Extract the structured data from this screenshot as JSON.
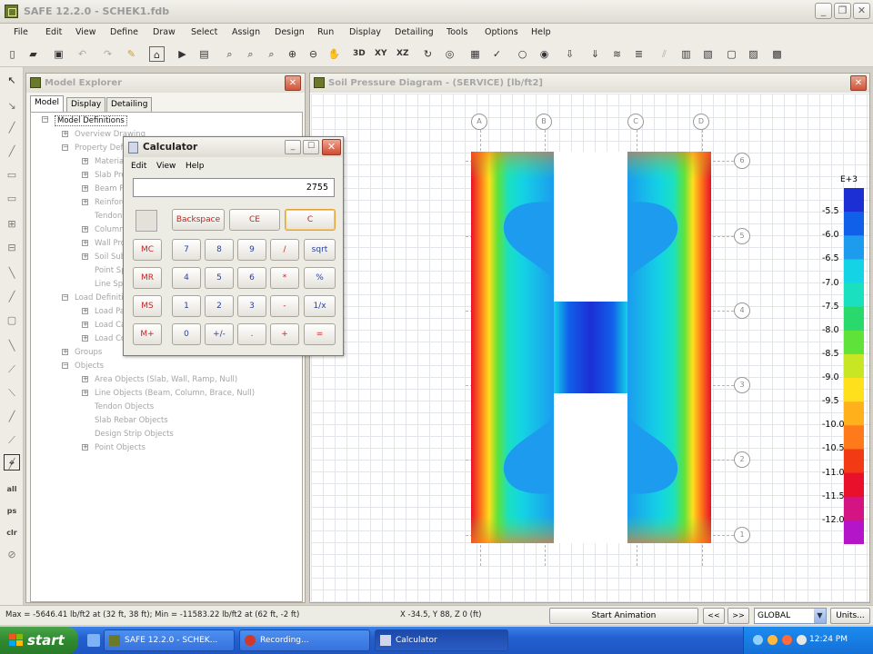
{
  "app": {
    "title": "SAFE 12.2.0 - SCHEK1.fdb"
  },
  "menu": [
    "File",
    "Edit",
    "View",
    "Define",
    "Draw",
    "Select",
    "Assign",
    "Design",
    "Run",
    "Display",
    "Detailing",
    "Tools",
    "Options",
    "Help"
  ],
  "toolbar": {
    "btn_3d": "3D",
    "btn_xy": "XY",
    "btn_xz": "XZ"
  },
  "left_toolbar": {
    "btn_all": "all",
    "btn_ps": "ps",
    "btn_clr": "clr"
  },
  "explorer": {
    "title": "Model Explorer",
    "tabs": [
      "Model",
      "Display",
      "Detailing"
    ],
    "tree": {
      "root": "Model Definitions",
      "drawing": "Overview Drawing",
      "property": "Property Definitions",
      "p1": "Materials",
      "p2": "Slab Properties",
      "p3": "Beam Properties",
      "p4": "Reinforcing Bar Sizes",
      "p5": "Tendon Properties",
      "p6": "Column Properties",
      "p7": "Wall Properties",
      "p8": "Soil Subgrade Properties",
      "p9": "Point Spring Properties",
      "p10": "Line Spring Properties",
      "load": "Load Definitions",
      "l1": "Load Patterns",
      "l2": "Load Cases",
      "l3": "Load Combinations",
      "groups": "Groups",
      "objects": "Objects",
      "o1": "Area Objects (Slab, Wall, Ramp, Null)",
      "o2": "Line Objects (Beam, Column, Brace, Null)",
      "o3": "Tendon Objects",
      "o4": "Slab Rebar Objects",
      "o5": "Design Strip Objects",
      "o6": "Point Objects"
    }
  },
  "plot": {
    "title": "Soil Pressure Diagram - (SERVICE)  [lb/ft2]",
    "grid_cols": [
      "A",
      "B",
      "C",
      "D"
    ],
    "grid_rows": [
      "6",
      "5",
      "4",
      "3",
      "2",
      "1"
    ]
  },
  "legend": {
    "exponent": "E+3",
    "values": [
      "-5.5",
      "-6.0",
      "-6.5",
      "-7.0",
      "-7.5",
      "-8.0",
      "-8.5",
      "-9.0",
      "-9.5",
      "-10.0",
      "-10.5",
      "-11.0",
      "-11.5",
      "-12.0"
    ],
    "colors": [
      "#1c2fd4",
      "#1160ea",
      "#1c9bef",
      "#13d3e4",
      "#1be0c0",
      "#29d96c",
      "#5fe33a",
      "#c8e624",
      "#ffe01d",
      "#ffb01b",
      "#ff7a1a",
      "#f23a14",
      "#e8102a",
      "#d31482",
      "#b415c8"
    ]
  },
  "calculator": {
    "title": "Calculator",
    "menu": [
      "Edit",
      "View",
      "Help"
    ],
    "display": "2755",
    "top_buttons": [
      "Backspace",
      "CE",
      "C"
    ],
    "mem_buttons": [
      "MC",
      "MR",
      "MS",
      "M+"
    ],
    "row1": [
      "7",
      "8",
      "9",
      "/",
      "sqrt"
    ],
    "row2": [
      "4",
      "5",
      "6",
      "*",
      "%"
    ],
    "row3": [
      "1",
      "2",
      "3",
      "-",
      "1/x"
    ],
    "row4": [
      "0",
      "+/-",
      ".",
      "+",
      "="
    ]
  },
  "status": {
    "maxmin": "Max = -5646.41 lb/ft2 at (32 ft, 38 ft);  Min = -11583.22 lb/ft2 at (62 ft, -2 ft)",
    "coords": "X -34.5,  Y 88,  Z 0  (ft)",
    "animation": "Start Animation",
    "prev": "<<",
    "next": ">>",
    "coord_system": "GLOBAL",
    "units": "Units..."
  },
  "taskbar": {
    "start": "start",
    "tasks": [
      "SAFE 12.2.0 - SCHEK...",
      "Recording...",
      "Calculator"
    ],
    "clock": "12:24 PM"
  }
}
